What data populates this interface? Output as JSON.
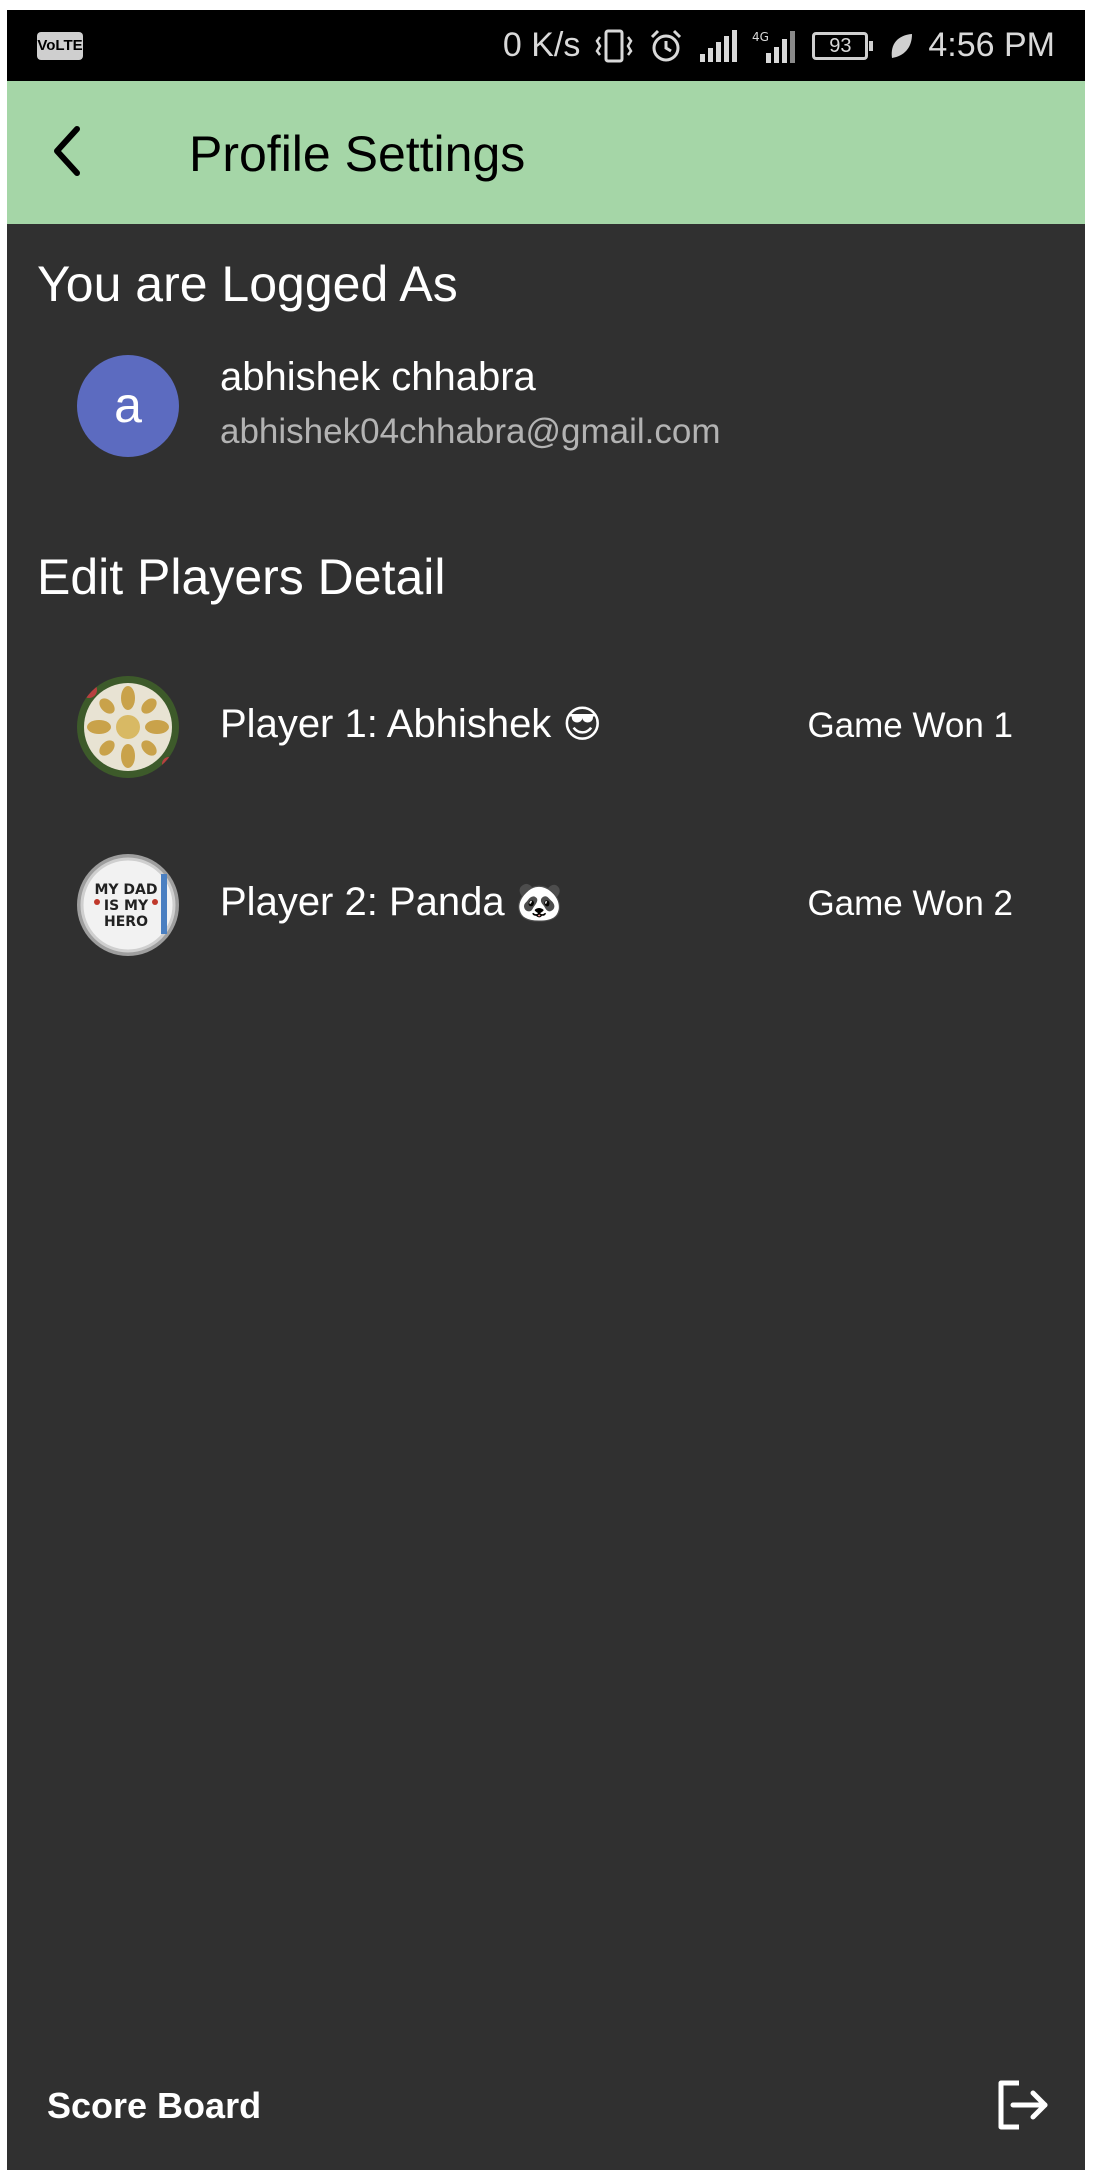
{
  "status_bar": {
    "volte_label": "VoLTE",
    "net_speed": "0 K/s",
    "network_type": "4G",
    "battery_level": "93",
    "time": "4:56 PM"
  },
  "app_bar": {
    "title": "Profile Settings",
    "back_icon": "arrow-back-icon",
    "color": "#a5d6a7"
  },
  "logged_in": {
    "heading": "You are Logged As",
    "avatar_letter": "a",
    "avatar_color": "#5c6bc0",
    "name": "abhishek chhabra",
    "email": "abhishek04chhabra@gmail.com"
  },
  "players_section": {
    "heading": "Edit Players Detail",
    "players": [
      {
        "label": "Player 1: Abhishek",
        "emoji": "😎",
        "wins": "Game Won 1",
        "avatar": "flower-plate-photo"
      },
      {
        "label": "Player 2: Panda",
        "emoji": "🐼",
        "wins": "Game Won 2",
        "avatar": "my-dad-is-my-hero-photo"
      }
    ],
    "avatar_text": [
      "MY DAD",
      "IS MY",
      "HERO"
    ]
  },
  "bottom": {
    "score_board_label": "Score Board",
    "logout_icon": "logout-icon"
  }
}
